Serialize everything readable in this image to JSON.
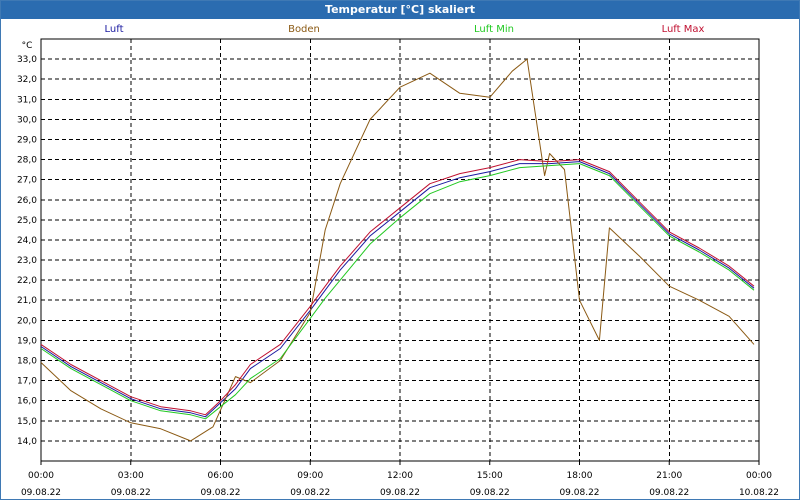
{
  "window": {
    "title": "Temperatur [°C] skaliert"
  },
  "colors": {
    "luft": "#1a1aa0",
    "boden": "#8b5a14",
    "luft_min": "#22c922",
    "luft_max": "#c01030"
  },
  "chart_data": {
    "type": "line",
    "title": "Temperatur [°C] skaliert",
    "ylabel": "°C",
    "ylim": [
      13.0,
      34.0
    ],
    "xlim_hours": [
      0,
      24
    ],
    "grid": true,
    "legend_position": "top",
    "y_ticks": [
      "33,0",
      "32,0",
      "31,0",
      "30,0",
      "29,0",
      "28,0",
      "27,0",
      "26,0",
      "25,0",
      "24,0",
      "23,0",
      "22,0",
      "21,0",
      "20,0",
      "19,0",
      "18,0",
      "17,0",
      "16,0",
      "15,0",
      "14,0"
    ],
    "x_ticks": [
      {
        "time": "00:00",
        "date": "09.08.22"
      },
      {
        "time": "03:00",
        "date": "09.08.22"
      },
      {
        "time": "06:00",
        "date": "09.08.22"
      },
      {
        "time": "09:00",
        "date": "09.08.22"
      },
      {
        "time": "12:00",
        "date": "09.08.22"
      },
      {
        "time": "15:00",
        "date": "09.08.22"
      },
      {
        "time": "18:00",
        "date": "09.08.22"
      },
      {
        "time": "21:00",
        "date": "09.08.22"
      },
      {
        "time": "00:00",
        "date": "10.08.22"
      }
    ],
    "series": [
      {
        "name": "Luft",
        "key": "luft",
        "x": [
          "00:00",
          "01:00",
          "02:00",
          "03:00",
          "04:00",
          "05:00",
          "05:30",
          "06:00",
          "06:30",
          "07:00",
          "08:00",
          "09:00",
          "09:30",
          "10:00",
          "11:00",
          "12:00",
          "13:00",
          "14:00",
          "15:00",
          "16:00",
          "17:00",
          "18:00",
          "19:00",
          "20:00",
          "21:00",
          "22:00",
          "23:00",
          "23:50"
        ],
        "y": [
          18.7,
          17.7,
          16.9,
          16.1,
          15.6,
          15.4,
          15.2,
          15.9,
          16.6,
          17.6,
          18.6,
          20.5,
          21.5,
          22.5,
          24.2,
          25.4,
          26.6,
          27.1,
          27.4,
          27.8,
          27.8,
          27.9,
          27.3,
          25.8,
          24.3,
          23.5,
          22.6,
          21.6
        ]
      },
      {
        "name": "Boden",
        "key": "boden",
        "x": [
          "00:00",
          "01:00",
          "02:00",
          "03:00",
          "04:00",
          "05:00",
          "05:45",
          "06:30",
          "07:00",
          "08:00",
          "09:00",
          "09:30",
          "10:00",
          "11:00",
          "12:00",
          "13:00",
          "14:00",
          "15:00",
          "15:45",
          "16:15",
          "16:50",
          "17:00",
          "17:30",
          "18:00",
          "18:40",
          "19:00",
          "20:00",
          "21:00",
          "22:00",
          "23:00",
          "23:50"
        ],
        "y": [
          17.9,
          16.5,
          15.6,
          14.9,
          14.6,
          14.0,
          14.7,
          17.2,
          16.9,
          18.0,
          20.4,
          24.5,
          26.8,
          30.0,
          31.6,
          32.3,
          31.3,
          31.1,
          32.4,
          33.0,
          27.2,
          28.3,
          27.5,
          21.0,
          19.0,
          24.6,
          23.2,
          21.7,
          21.0,
          20.2,
          18.8
        ]
      },
      {
        "name": "Luft Min",
        "key": "luft_min",
        "x": [
          "00:00",
          "01:00",
          "02:00",
          "03:00",
          "04:00",
          "05:00",
          "05:30",
          "06:00",
          "06:30",
          "07:00",
          "08:00",
          "09:00",
          "09:30",
          "10:00",
          "11:00",
          "12:00",
          "13:00",
          "14:00",
          "15:00",
          "16:00",
          "17:00",
          "18:00",
          "19:00",
          "20:00",
          "21:00",
          "22:00",
          "23:00",
          "23:50"
        ],
        "y": [
          18.6,
          17.6,
          16.8,
          16.0,
          15.5,
          15.3,
          15.1,
          15.7,
          16.3,
          17.1,
          18.1,
          20.1,
          21.1,
          22.0,
          23.8,
          25.1,
          26.3,
          26.9,
          27.2,
          27.6,
          27.7,
          27.8,
          27.2,
          25.7,
          24.2,
          23.4,
          22.5,
          21.5
        ]
      },
      {
        "name": "Luft Max",
        "key": "luft_max",
        "x": [
          "00:00",
          "01:00",
          "02:00",
          "03:00",
          "04:00",
          "05:00",
          "05:30",
          "06:00",
          "06:30",
          "07:00",
          "08:00",
          "09:00",
          "09:30",
          "10:00",
          "11:00",
          "12:00",
          "13:00",
          "14:00",
          "15:00",
          "16:00",
          "17:00",
          "18:00",
          "19:00",
          "20:00",
          "21:00",
          "22:00",
          "23:00",
          "23:50"
        ],
        "y": [
          18.8,
          17.8,
          17.0,
          16.2,
          15.7,
          15.5,
          15.3,
          16.0,
          16.8,
          17.8,
          18.8,
          20.7,
          21.7,
          22.7,
          24.4,
          25.6,
          26.8,
          27.3,
          27.6,
          28.0,
          27.9,
          28.0,
          27.4,
          25.9,
          24.4,
          23.6,
          22.7,
          21.7
        ]
      }
    ]
  }
}
